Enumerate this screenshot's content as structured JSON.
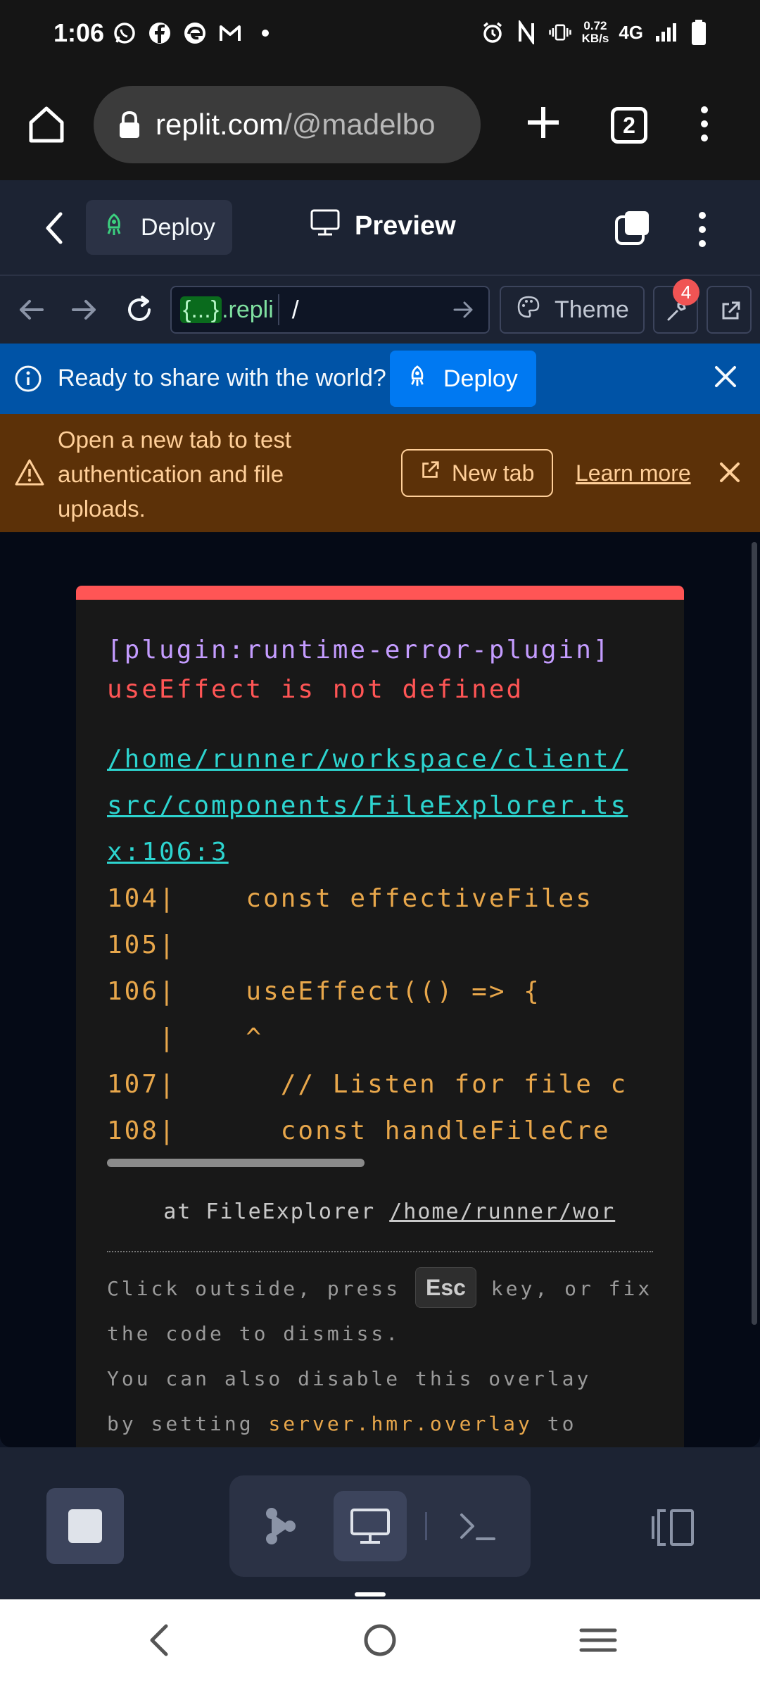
{
  "status_bar": {
    "time": "1:06",
    "net_speed_value": "0.72",
    "net_speed_unit": "KB/s",
    "network_type": "4G"
  },
  "browser": {
    "url_host": "replit.com",
    "url_rest": "/@madelbo",
    "tab_count": "2"
  },
  "replit_header": {
    "deploy_label": "Deploy",
    "preview_label": "Preview"
  },
  "webview_toolbar": {
    "host_badge": "{...}",
    "host_suffix": ".repli",
    "path_value": "/",
    "theme_label": "Theme",
    "devtools_badge": "4"
  },
  "deploy_banner": {
    "message": "Ready to share with the world?",
    "button_label": "Deploy"
  },
  "warning_banner": {
    "message": "Open a new tab to test authentication and file uploads.",
    "new_tab_label": "New tab",
    "learn_more_label": "Learn more"
  },
  "error_overlay": {
    "plugin": "[plugin:runtime-error-plugin]",
    "message": "useEffect is not defined",
    "file_path": "/home/runner/workspace/client/src/components/FileExplorer.tsx:106:3",
    "code_lines": [
      "104|    const effectiveFiles",
      "105|",
      "106|    useEffect(() => {",
      "   |    ^",
      "107|      // Listen for file c",
      "108|      const handleFileCre"
    ],
    "stack_prefix": "    at FileExplorer ",
    "stack_link": "/home/runner/wor",
    "tip_before_key": "Click outside, press ",
    "tip_key": "Esc",
    "tip_after_key": " key, or fix the code to dismiss.",
    "tip_line2": "You can also disable this overlay",
    "tip_line3_prefix": "by setting ",
    "tip_line3_code": "server.hmr.overlay",
    "tip_line3_suffix": " to"
  },
  "colors": {
    "error_accent": "#ff5555",
    "deploy_banner_bg": "#0053a6",
    "warning_banner_bg": "#5c3108",
    "link_teal": "#2dd4cf",
    "code_orange": "#e8a74b"
  }
}
